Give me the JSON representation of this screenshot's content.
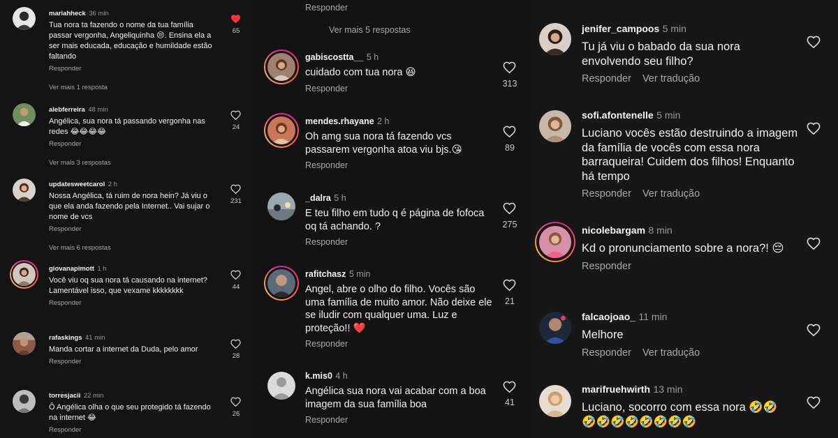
{
  "panel_left": {
    "comments": [
      {
        "user": "mariahheck",
        "time": "36 min",
        "text": "Tua nora ta fazendo o nome da tua família passar vergonha, Angeliquinha 😒. Ensina ela a ser mais educada, educação e humildade estão faltando",
        "reply": "Responder",
        "likes": "65",
        "liked": true,
        "more": "Ver mais 1 resposta"
      },
      {
        "user": "alebferreira",
        "time": "48 min",
        "text": "Angélica, sua nora tá passando vergonha nas redes 😂😂😂😂",
        "reply": "Responder",
        "likes": "24",
        "more": "Ver mais 3 respostas"
      },
      {
        "user": "updatesweetcarol",
        "time": "2 h",
        "text": "Nossa Angélica, tá ruim de nora hein? Já viu o que ela anda fazendo pela Internet.. Vai sujar o nome de vcs",
        "reply": "Responder",
        "likes": "231",
        "more": "Ver mais 6 respostas"
      },
      {
        "user": "giovanapimott",
        "time": "1 h",
        "text": "Você viu oq sua nora tá causando na internet? Lamentável isso, que vexame kkkkkkkk",
        "reply": "Responder",
        "likes": "44"
      },
      {
        "user": "rafaskings",
        "time": "41 min",
        "text": "Manda cortar a internet da Duda, pelo amor",
        "reply": "Responder",
        "likes": "28"
      },
      {
        "user": "torresjacii",
        "time": "22 min",
        "text": "Ô Angélica olha o que seu protegido tá fazendo na internet 😂",
        "reply": "Responder",
        "likes": "26"
      }
    ]
  },
  "panel_middle": {
    "top_reply": "Responder",
    "more": "Ver mais 5 respostas",
    "comments": [
      {
        "user": "gabiscostta__",
        "time": "5 h",
        "text": "cuidado com tua nora 😆",
        "reply": "Responder",
        "likes": "313"
      },
      {
        "user": "mendes.rhayane",
        "time": "2 h",
        "text": "Oh amg sua nora tá fazendo vcs passarem vergonha atoa viu bjs.😘",
        "reply": "Responder",
        "likes": "89"
      },
      {
        "user": "_dalra",
        "time": "5 h",
        "text": "E teu filho em tudo q é página de fofoca oq tá achando. ?",
        "reply": "Responder",
        "likes": "275"
      },
      {
        "user": "rafitchasz",
        "time": "5 min",
        "text": "Angel, abre o olho do filho. Vocês são uma família de muito amor. Não deixe ele se iludir com qualquer uma. Luz e proteção!! ❤️",
        "reply": "Responder",
        "likes": "21"
      },
      {
        "user": "k.mis0",
        "time": "4 h",
        "text": "Angélica sua nora vai acabar com a boa imagem da sua família boa",
        "reply": "Responder",
        "likes": "41"
      }
    ]
  },
  "panel_right": {
    "translate_label": "Ver tradução",
    "comments": [
      {
        "user": "jenifer_campoos",
        "time": "5 min",
        "text": "Tu já viu o babado da sua nora envolvendo seu filho?",
        "reply": "Responder",
        "translate": true
      },
      {
        "user": "sofi.afontenelle",
        "time": "5 min",
        "text": "Luciano vocês estão destruindo a imagem da família de vocês com essa nora barraqueira! Cuidem dos filhos! Enquanto há tempo",
        "reply": "Responder",
        "translate": true
      },
      {
        "user": "nicolebargam",
        "time": "8 min",
        "text": "Kd o pronunciamento sobre a nora?! 😔",
        "reply": "Responder",
        "translate": false
      },
      {
        "user": "falcaojoao_",
        "time": "11 min",
        "text": "Melhore",
        "reply": "Responder",
        "translate": true
      },
      {
        "user": "marifruehwirth",
        "time": "13 min",
        "text": "Luciano, socorro com essa nora 🤣🤣 🤣🤣🤣🤣🤣🤣🤣🤣",
        "reply": "",
        "translate": false
      }
    ]
  },
  "icons": {
    "heart": "heart-icon",
    "heart_filled": "heart-filled-icon",
    "avatar": "avatar-icon"
  },
  "colors": {
    "background": "#121212",
    "liked_heart": "#ff3040",
    "story_ring": "#d6249f"
  }
}
